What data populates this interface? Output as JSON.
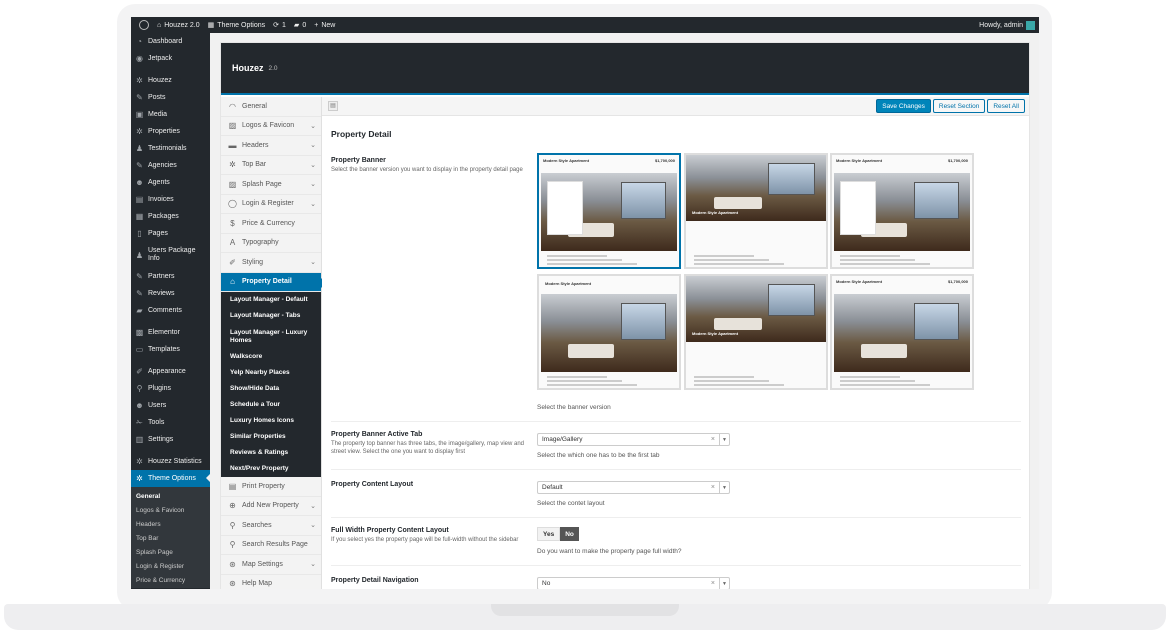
{
  "adminbar": {
    "site_name": "Houzez 2.0",
    "theme_options": "Theme Options",
    "updates": "1",
    "comments": "0",
    "new_label": "New",
    "greeting": "Howdy, admin"
  },
  "sidebar": {
    "items": [
      {
        "label": "Dashboard",
        "icon": "dashboard-icon"
      },
      {
        "label": "Jetpack",
        "icon": "jetpack-icon"
      },
      {
        "label": "Houzez",
        "icon": "gear-icon"
      },
      {
        "label": "Posts",
        "icon": "pin-icon"
      },
      {
        "label": "Media",
        "icon": "media-icon"
      },
      {
        "label": "Properties",
        "icon": "gear-icon"
      },
      {
        "label": "Testimonials",
        "icon": "people-icon"
      },
      {
        "label": "Agencies",
        "icon": "pin-icon"
      },
      {
        "label": "Agents",
        "icon": "person-icon"
      },
      {
        "label": "Invoices",
        "icon": "invoice-icon"
      },
      {
        "label": "Packages",
        "icon": "package-icon"
      },
      {
        "label": "Pages",
        "icon": "page-icon"
      },
      {
        "label": "Users Package Info",
        "icon": "people-icon"
      },
      {
        "label": "Partners",
        "icon": "pin-icon"
      },
      {
        "label": "Reviews",
        "icon": "pin-icon"
      },
      {
        "label": "Comments",
        "icon": "comment-icon"
      },
      {
        "label": "Elementor",
        "icon": "elementor-icon"
      },
      {
        "label": "Templates",
        "icon": "folder-icon"
      },
      {
        "label": "Appearance",
        "icon": "brush-icon"
      },
      {
        "label": "Plugins",
        "icon": "plugin-icon"
      },
      {
        "label": "Users",
        "icon": "person-icon"
      },
      {
        "label": "Tools",
        "icon": "wrench-icon"
      },
      {
        "label": "Settings",
        "icon": "settings-icon"
      },
      {
        "label": "Houzez Statistics",
        "icon": "gear-icon"
      },
      {
        "label": "Theme Options",
        "icon": "gear-icon"
      }
    ],
    "submenu": [
      "General",
      "Logos & Favicon",
      "Headers",
      "Top Bar",
      "Splash Page",
      "Login & Register",
      "Price & Currency"
    ]
  },
  "panel": {
    "title": "Houzez",
    "version": "2.0"
  },
  "options_nav": {
    "items_top": [
      {
        "label": "General",
        "icon": "gauge-icon",
        "chevron": false
      },
      {
        "label": "Logos & Favicon",
        "icon": "image-icon",
        "chevron": true
      },
      {
        "label": "Headers",
        "icon": "header-icon",
        "chevron": true
      },
      {
        "label": "Top Bar",
        "icon": "gear-icon",
        "chevron": true
      },
      {
        "label": "Splash Page",
        "icon": "image-icon",
        "chevron": true
      },
      {
        "label": "Login & Register",
        "icon": "user-circle-icon",
        "chevron": true
      },
      {
        "label": "Price & Currency",
        "icon": "dollar-icon",
        "chevron": false
      },
      {
        "label": "Typography",
        "icon": "typography-icon",
        "chevron": false
      },
      {
        "label": "Styling",
        "icon": "brush-icon",
        "chevron": true
      },
      {
        "label": "Property Detail",
        "icon": "home-icon",
        "chevron": false
      }
    ],
    "subitems": [
      "Layout Manager - Default",
      "Layout Manager - Tabs",
      "Layout Manager - Luxury Homes",
      "Walkscore",
      "Yelp Nearby Places",
      "Show/Hide Data",
      "Schedule a Tour",
      "Luxury Homes Icons",
      "Similar Properties",
      "Reviews & Ratings",
      "Next/Prev Property"
    ],
    "items_bottom": [
      {
        "label": "Print Property",
        "icon": "print-icon",
        "chevron": false
      },
      {
        "label": "Add New Property",
        "icon": "plus-circle-icon",
        "chevron": true
      },
      {
        "label": "Searches",
        "icon": "search-icon",
        "chevron": true
      },
      {
        "label": "Search Results Page",
        "icon": "search-icon",
        "chevron": false
      },
      {
        "label": "Map Settings",
        "icon": "map-icon",
        "chevron": true
      },
      {
        "label": "Help Map",
        "icon": "map-icon",
        "chevron": false
      }
    ]
  },
  "toolbar": {
    "save": "Save Changes",
    "reset_section": "Reset Section",
    "reset_all": "Reset All"
  },
  "section": {
    "title": "Property Detail",
    "banner": {
      "label": "Property Banner",
      "desc": "Select the banner version you want to display in the property detail page",
      "hint": "Select the banner version",
      "thumb_heading": "Modern Style Apartment",
      "thumb_price": "$1,700,000"
    },
    "active_tab": {
      "label": "Property Banner Active Tab",
      "desc": "The property top banner has three tabs, the image/gallery, map view and street view. Select the one you want to display first",
      "value": "Image/Gallery",
      "hint": "Select the which one has to be the first tab"
    },
    "content_layout": {
      "label": "Property Content Layout",
      "value": "Default",
      "hint": "Select the contet layout"
    },
    "full_width": {
      "label": "Full Width Property Content Layout",
      "desc": "If you select yes the property page will be full-width without the sidebar",
      "yes": "Yes",
      "no": "No",
      "hint": "Do you want to make the property page full width?"
    },
    "navigation": {
      "label": "Property Detail Navigation",
      "value": "No"
    }
  }
}
